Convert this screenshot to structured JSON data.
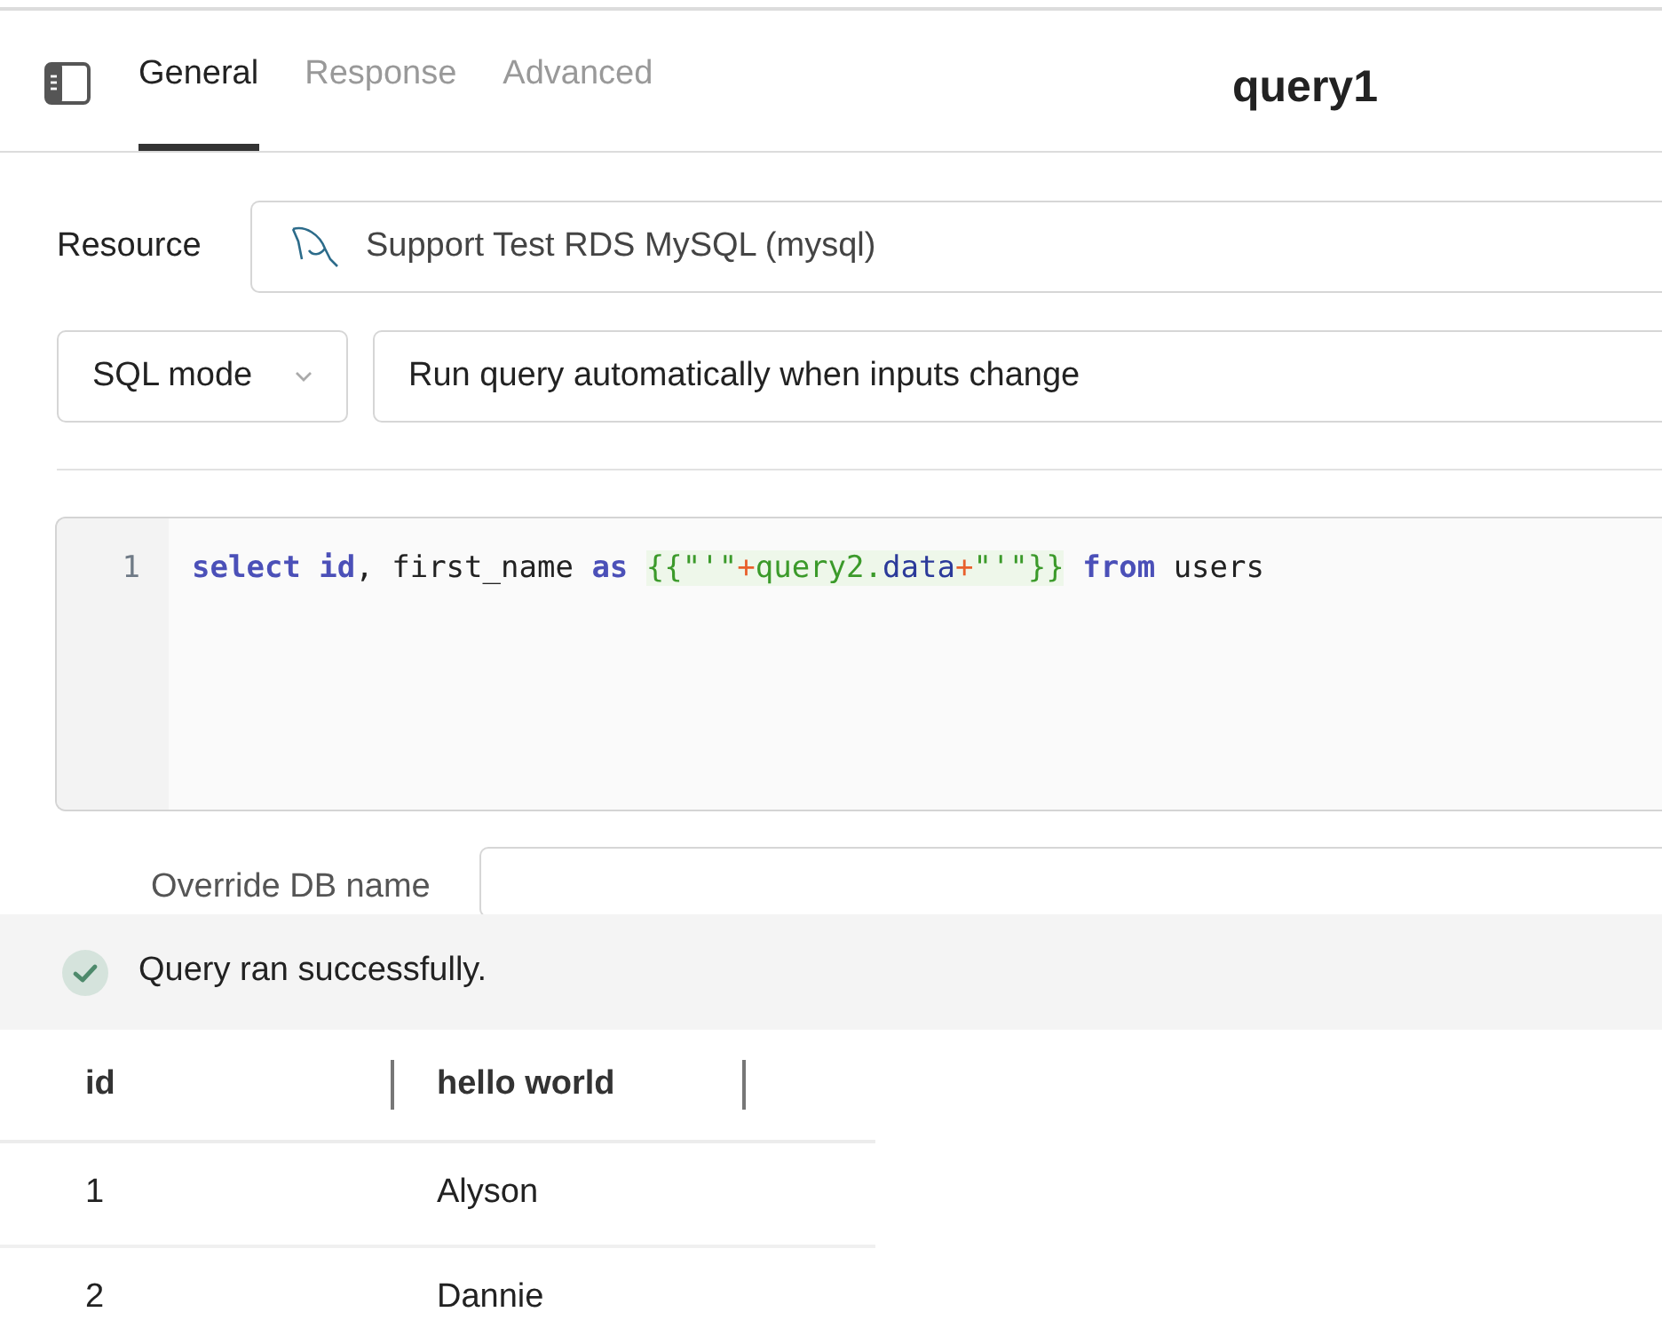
{
  "tabs": [
    {
      "label": "General",
      "selected": true
    },
    {
      "label": "Response",
      "selected": false
    },
    {
      "label": "Advanced",
      "selected": false
    }
  ],
  "query_title": "query1",
  "resource": {
    "label": "Resource",
    "value": "Support Test RDS MySQL (mysql)"
  },
  "mode_select": {
    "value": "SQL mode"
  },
  "run_behavior": {
    "value": "Run query automatically when inputs change"
  },
  "editor": {
    "lines": [
      {
        "number": "1",
        "tokens": [
          {
            "kind": "keyword",
            "text": "select id"
          },
          {
            "kind": "plain",
            "text": ", first_name "
          },
          {
            "kind": "keyword",
            "text": "as "
          },
          {
            "kind": "template",
            "text": "{{\"'\""
          },
          {
            "kind": "operator",
            "text": "+"
          },
          {
            "kind": "template",
            "text": "query2."
          },
          {
            "kind": "property",
            "text": "data"
          },
          {
            "kind": "operator",
            "text": "+"
          },
          {
            "kind": "template",
            "text": "\"'\"}}"
          },
          {
            "kind": "keyword",
            "text": " from"
          },
          {
            "kind": "plain",
            "text": " users"
          }
        ]
      }
    ]
  },
  "override_db": {
    "label": "Override DB name"
  },
  "status": {
    "message": "Query ran successfully."
  },
  "table": {
    "columns": [
      "id",
      "hello world"
    ],
    "rows": [
      [
        "1",
        "Alyson"
      ],
      [
        "2",
        "Dannie"
      ]
    ]
  }
}
